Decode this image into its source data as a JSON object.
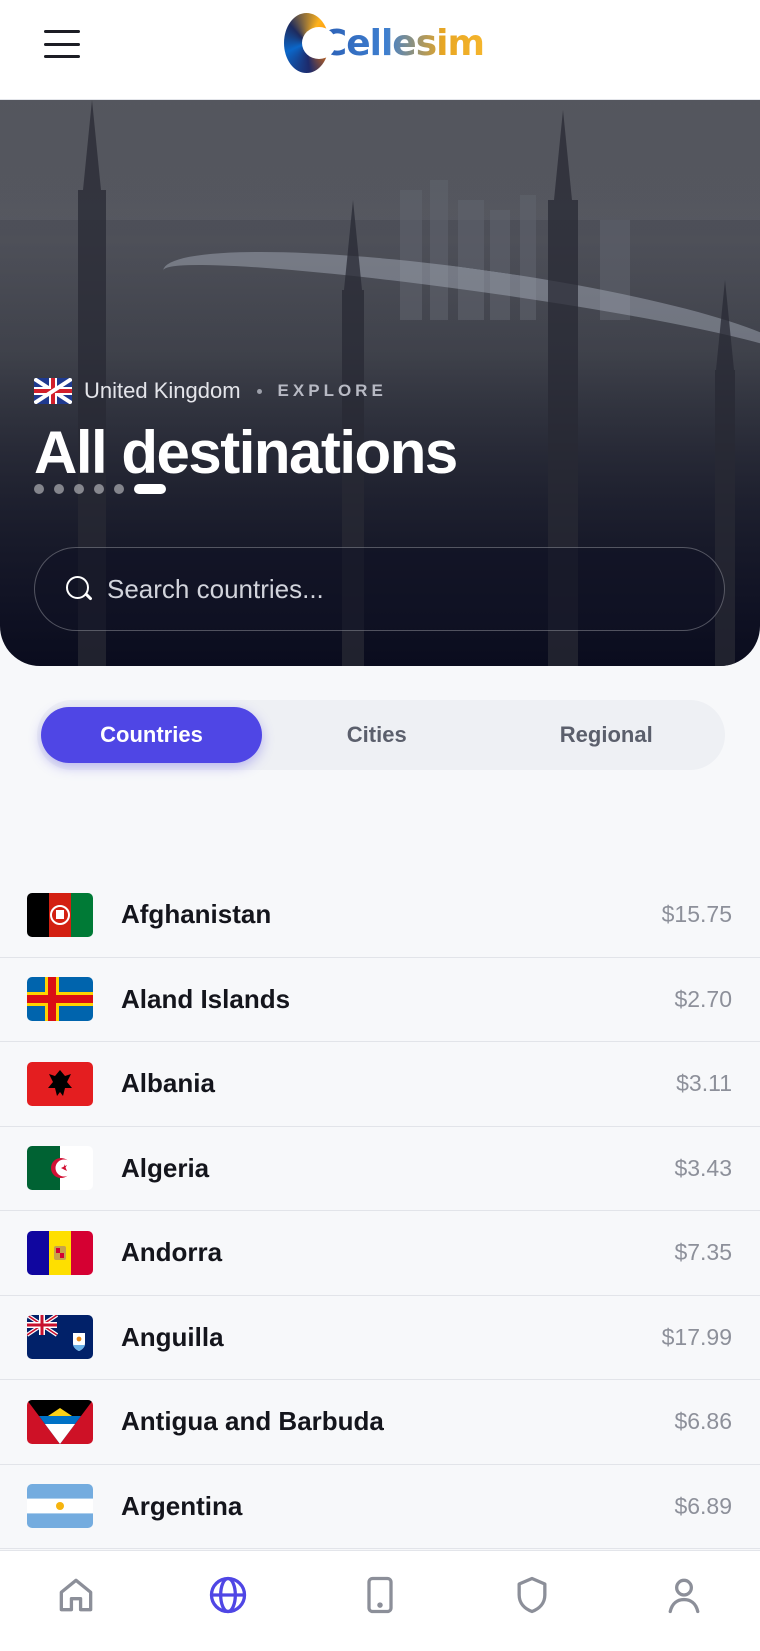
{
  "header": {
    "logo_text": "Cellesim"
  },
  "hero": {
    "location": "United Kingdom",
    "explore_label": "EXPLORE",
    "title": "All destinations",
    "carousel_total": 6,
    "carousel_active_index": 5
  },
  "search": {
    "placeholder": "Search countries..."
  },
  "tabs": [
    {
      "label": "Countries",
      "active": true
    },
    {
      "label": "Cities",
      "active": false
    },
    {
      "label": "Regional",
      "active": false
    }
  ],
  "countries": [
    {
      "name": "Afghanistan",
      "price": "$15.75",
      "flag": "afghanistan"
    },
    {
      "name": "Aland Islands",
      "price": "$2.70",
      "flag": "aland-islands"
    },
    {
      "name": "Albania",
      "price": "$3.11",
      "flag": "albania"
    },
    {
      "name": "Algeria",
      "price": "$3.43",
      "flag": "algeria"
    },
    {
      "name": "Andorra",
      "price": "$7.35",
      "flag": "andorra"
    },
    {
      "name": "Anguilla",
      "price": "$17.99",
      "flag": "anguilla"
    },
    {
      "name": "Antigua and Barbuda",
      "price": "$6.86",
      "flag": "antigua-and-barbuda"
    },
    {
      "name": "Argentina",
      "price": "$6.89",
      "flag": "argentina"
    }
  ],
  "bottom_nav": [
    {
      "icon": "home-icon",
      "active": false
    },
    {
      "icon": "globe-icon",
      "active": true
    },
    {
      "icon": "device-icon",
      "active": false
    },
    {
      "icon": "shield-icon",
      "active": false
    },
    {
      "icon": "user-icon",
      "active": false
    }
  ],
  "colors": {
    "accent": "#4f46e5",
    "nav_inactive": "#8c8f99"
  }
}
